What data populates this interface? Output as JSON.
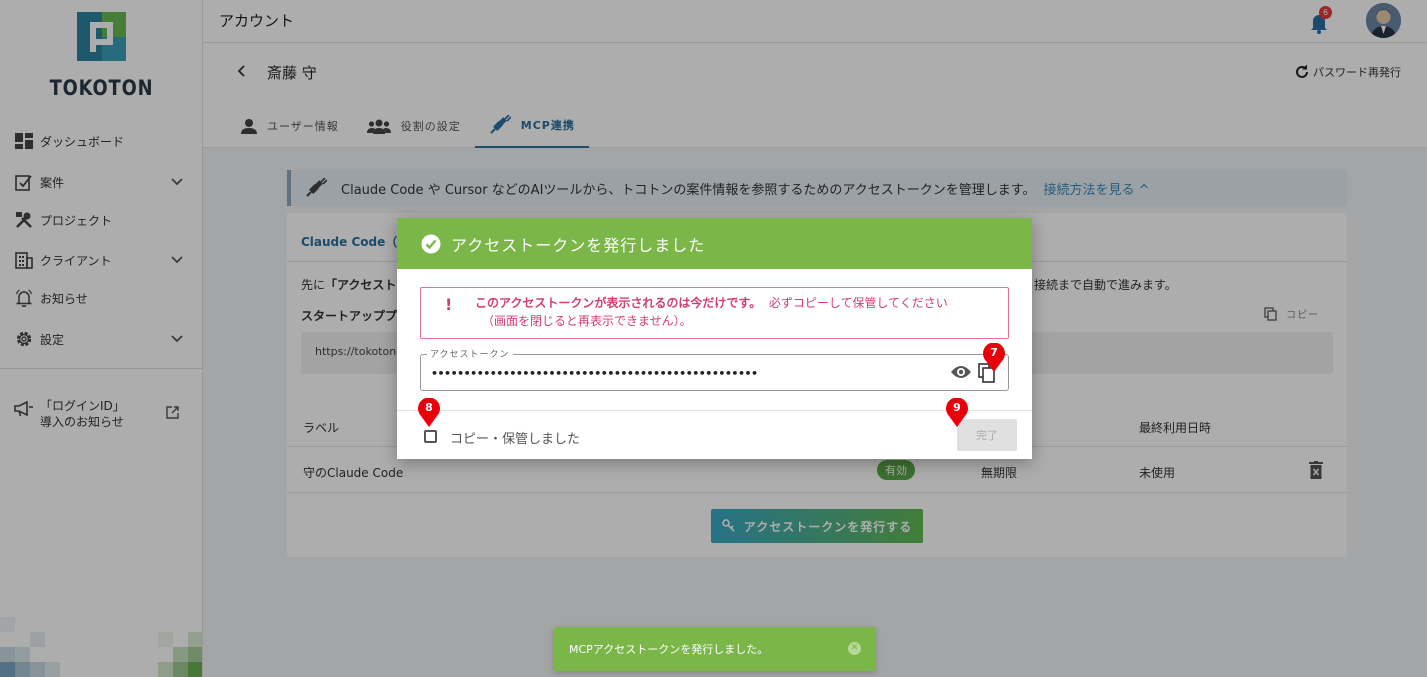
{
  "brand": {
    "name": "TOKOTON"
  },
  "sidebar": {
    "items": [
      {
        "label": "ダッシュボード",
        "icon": "dashboard-icon",
        "expandable": false
      },
      {
        "label": "案件",
        "icon": "case-icon",
        "expandable": true
      },
      {
        "label": "プロジェクト",
        "icon": "tools-icon",
        "expandable": false
      },
      {
        "label": "クライアント",
        "icon": "building-icon",
        "expandable": true
      },
      {
        "label": "お知らせ",
        "icon": "bell-outline-icon",
        "expandable": false
      },
      {
        "label": "設定",
        "icon": "gear-icon",
        "expandable": true
      }
    ],
    "promo": {
      "line1": "「ログインID」",
      "line2": "導入のお知らせ"
    }
  },
  "header": {
    "title": "アカウント",
    "notification_count": "6"
  },
  "subheader": {
    "user_name": "斎藤 守",
    "password_reset_label": "パスワード再発行",
    "tabs": [
      {
        "label": "ユーザー情報",
        "active": false
      },
      {
        "label": "役割の設定",
        "active": false
      },
      {
        "label": "MCP連携",
        "active": true
      }
    ]
  },
  "main": {
    "banner_text": "Claude Code や Cursor などのAIツールから、トコトンの案件情報を参照するためのアクセストークンを管理します。",
    "banner_link": "接続方法を見る ^",
    "card_tab": "Claude Code（推",
    "intro_prefix": "先に",
    "intro_bold": "「アクセスト",
    "intro_right": "ら接続まで自動で進みます。",
    "startup_label": "スタートアッププ",
    "copy_label": "コピー",
    "url_text": "https://tokoton-n",
    "table": {
      "headers": [
        "ラベル",
        "最終利用日時"
      ],
      "rows": [
        {
          "label": "守のClaude Code",
          "status": "有効",
          "expiry": "無期限",
          "last_used": "未使用"
        }
      ]
    },
    "issue_button": "アクセストークンを発行する"
  },
  "dialog": {
    "title": "アクセストークンを発行しました",
    "warning_bold": "このアクセストークンが表示されるのは今だけです。",
    "warning_rest": "必ずコピーして保管してください",
    "warning_line2": "（画面を閉じると再表示できません）。",
    "token_label": "アクセストークン",
    "token_value": "••••••••••••••••••••••••••••••••••••••••••••••••••",
    "checkbox_label": "コピー・保管しました",
    "done_label": "完了"
  },
  "markers": {
    "m7": "7",
    "m8": "8",
    "m9": "9"
  },
  "toast": {
    "text": "MCPアクセストークンを発行しました。"
  },
  "colors": {
    "accent": "#2a6f9e",
    "success": "#7ab648",
    "danger": "#d23f6e",
    "marker": "#e8000b"
  }
}
